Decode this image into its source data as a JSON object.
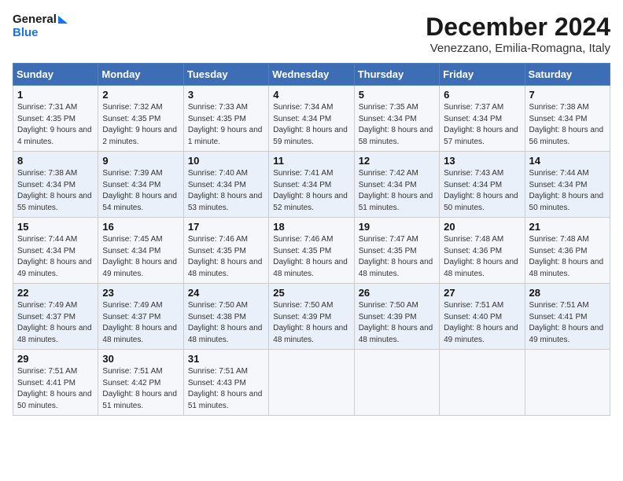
{
  "logo": {
    "line1": "General",
    "line2": "Blue"
  },
  "title": "December 2024",
  "subtitle": "Venezzano, Emilia-Romagna, Italy",
  "headers": [
    "Sunday",
    "Monday",
    "Tuesday",
    "Wednesday",
    "Thursday",
    "Friday",
    "Saturday"
  ],
  "weeks": [
    [
      {
        "day": "1",
        "sunrise": "Sunrise: 7:31 AM",
        "sunset": "Sunset: 4:35 PM",
        "daylight": "Daylight: 9 hours and 4 minutes."
      },
      {
        "day": "2",
        "sunrise": "Sunrise: 7:32 AM",
        "sunset": "Sunset: 4:35 PM",
        "daylight": "Daylight: 9 hours and 2 minutes."
      },
      {
        "day": "3",
        "sunrise": "Sunrise: 7:33 AM",
        "sunset": "Sunset: 4:35 PM",
        "daylight": "Daylight: 9 hours and 1 minute."
      },
      {
        "day": "4",
        "sunrise": "Sunrise: 7:34 AM",
        "sunset": "Sunset: 4:34 PM",
        "daylight": "Daylight: 8 hours and 59 minutes."
      },
      {
        "day": "5",
        "sunrise": "Sunrise: 7:35 AM",
        "sunset": "Sunset: 4:34 PM",
        "daylight": "Daylight: 8 hours and 58 minutes."
      },
      {
        "day": "6",
        "sunrise": "Sunrise: 7:37 AM",
        "sunset": "Sunset: 4:34 PM",
        "daylight": "Daylight: 8 hours and 57 minutes."
      },
      {
        "day": "7",
        "sunrise": "Sunrise: 7:38 AM",
        "sunset": "Sunset: 4:34 PM",
        "daylight": "Daylight: 8 hours and 56 minutes."
      }
    ],
    [
      {
        "day": "8",
        "sunrise": "Sunrise: 7:38 AM",
        "sunset": "Sunset: 4:34 PM",
        "daylight": "Daylight: 8 hours and 55 minutes."
      },
      {
        "day": "9",
        "sunrise": "Sunrise: 7:39 AM",
        "sunset": "Sunset: 4:34 PM",
        "daylight": "Daylight: 8 hours and 54 minutes."
      },
      {
        "day": "10",
        "sunrise": "Sunrise: 7:40 AM",
        "sunset": "Sunset: 4:34 PM",
        "daylight": "Daylight: 8 hours and 53 minutes."
      },
      {
        "day": "11",
        "sunrise": "Sunrise: 7:41 AM",
        "sunset": "Sunset: 4:34 PM",
        "daylight": "Daylight: 8 hours and 52 minutes."
      },
      {
        "day": "12",
        "sunrise": "Sunrise: 7:42 AM",
        "sunset": "Sunset: 4:34 PM",
        "daylight": "Daylight: 8 hours and 51 minutes."
      },
      {
        "day": "13",
        "sunrise": "Sunrise: 7:43 AM",
        "sunset": "Sunset: 4:34 PM",
        "daylight": "Daylight: 8 hours and 50 minutes."
      },
      {
        "day": "14",
        "sunrise": "Sunrise: 7:44 AM",
        "sunset": "Sunset: 4:34 PM",
        "daylight": "Daylight: 8 hours and 50 minutes."
      }
    ],
    [
      {
        "day": "15",
        "sunrise": "Sunrise: 7:44 AM",
        "sunset": "Sunset: 4:34 PM",
        "daylight": "Daylight: 8 hours and 49 minutes."
      },
      {
        "day": "16",
        "sunrise": "Sunrise: 7:45 AM",
        "sunset": "Sunset: 4:34 PM",
        "daylight": "Daylight: 8 hours and 49 minutes."
      },
      {
        "day": "17",
        "sunrise": "Sunrise: 7:46 AM",
        "sunset": "Sunset: 4:35 PM",
        "daylight": "Daylight: 8 hours and 48 minutes."
      },
      {
        "day": "18",
        "sunrise": "Sunrise: 7:46 AM",
        "sunset": "Sunset: 4:35 PM",
        "daylight": "Daylight: 8 hours and 48 minutes."
      },
      {
        "day": "19",
        "sunrise": "Sunrise: 7:47 AM",
        "sunset": "Sunset: 4:35 PM",
        "daylight": "Daylight: 8 hours and 48 minutes."
      },
      {
        "day": "20",
        "sunrise": "Sunrise: 7:48 AM",
        "sunset": "Sunset: 4:36 PM",
        "daylight": "Daylight: 8 hours and 48 minutes."
      },
      {
        "day": "21",
        "sunrise": "Sunrise: 7:48 AM",
        "sunset": "Sunset: 4:36 PM",
        "daylight": "Daylight: 8 hours and 48 minutes."
      }
    ],
    [
      {
        "day": "22",
        "sunrise": "Sunrise: 7:49 AM",
        "sunset": "Sunset: 4:37 PM",
        "daylight": "Daylight: 8 hours and 48 minutes."
      },
      {
        "day": "23",
        "sunrise": "Sunrise: 7:49 AM",
        "sunset": "Sunset: 4:37 PM",
        "daylight": "Daylight: 8 hours and 48 minutes."
      },
      {
        "day": "24",
        "sunrise": "Sunrise: 7:50 AM",
        "sunset": "Sunset: 4:38 PM",
        "daylight": "Daylight: 8 hours and 48 minutes."
      },
      {
        "day": "25",
        "sunrise": "Sunrise: 7:50 AM",
        "sunset": "Sunset: 4:39 PM",
        "daylight": "Daylight: 8 hours and 48 minutes."
      },
      {
        "day": "26",
        "sunrise": "Sunrise: 7:50 AM",
        "sunset": "Sunset: 4:39 PM",
        "daylight": "Daylight: 8 hours and 48 minutes."
      },
      {
        "day": "27",
        "sunrise": "Sunrise: 7:51 AM",
        "sunset": "Sunset: 4:40 PM",
        "daylight": "Daylight: 8 hours and 49 minutes."
      },
      {
        "day": "28",
        "sunrise": "Sunrise: 7:51 AM",
        "sunset": "Sunset: 4:41 PM",
        "daylight": "Daylight: 8 hours and 49 minutes."
      }
    ],
    [
      {
        "day": "29",
        "sunrise": "Sunrise: 7:51 AM",
        "sunset": "Sunset: 4:41 PM",
        "daylight": "Daylight: 8 hours and 50 minutes."
      },
      {
        "day": "30",
        "sunrise": "Sunrise: 7:51 AM",
        "sunset": "Sunset: 4:42 PM",
        "daylight": "Daylight: 8 hours and 51 minutes."
      },
      {
        "day": "31",
        "sunrise": "Sunrise: 7:51 AM",
        "sunset": "Sunset: 4:43 PM",
        "daylight": "Daylight: 8 hours and 51 minutes."
      },
      null,
      null,
      null,
      null
    ]
  ]
}
